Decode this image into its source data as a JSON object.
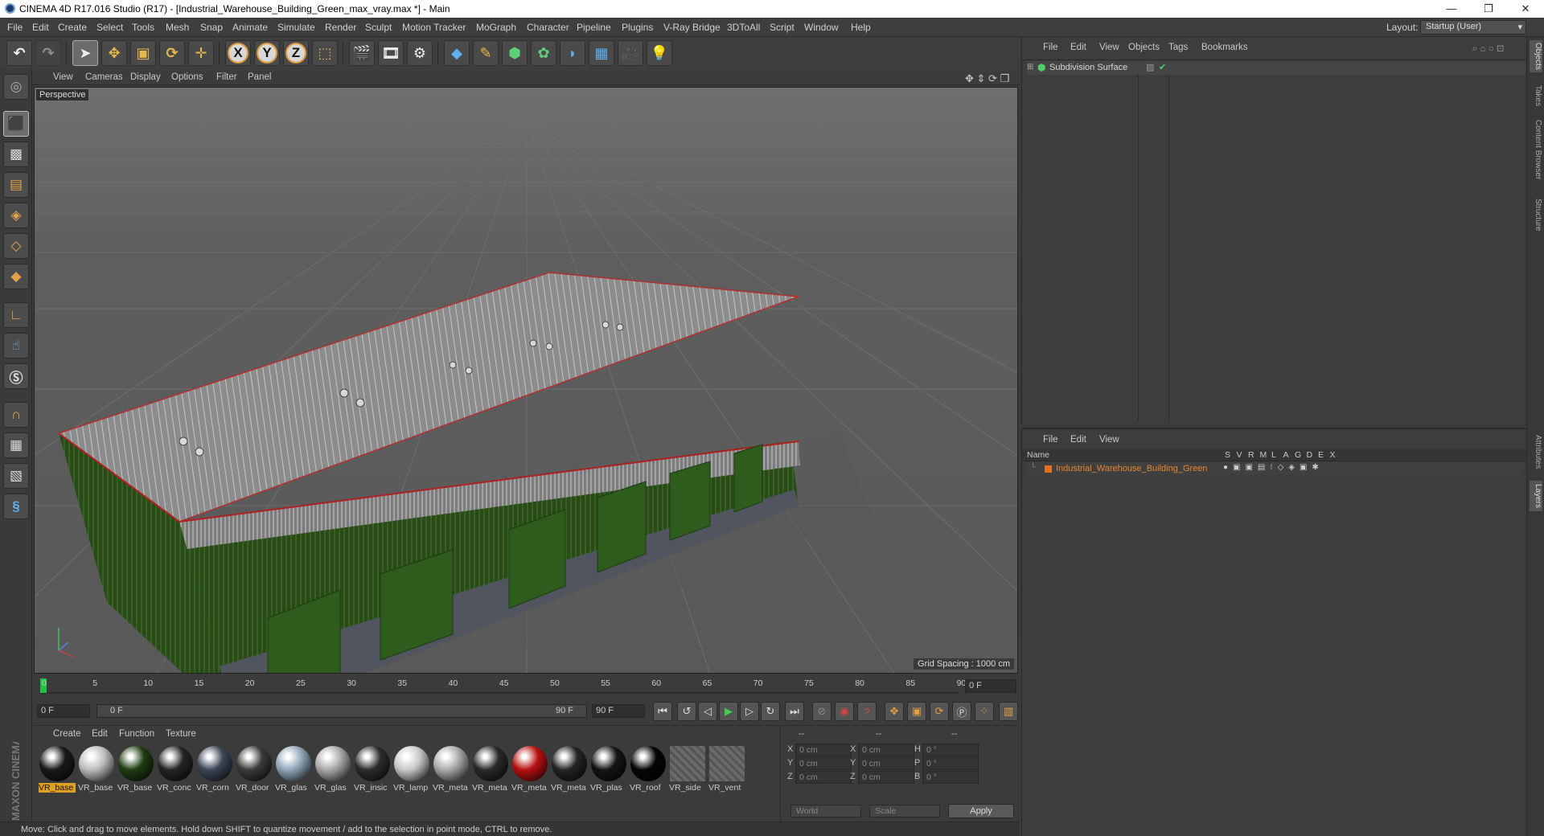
{
  "window": {
    "title": "CINEMA 4D R17.016 Studio (R17) - [Industrial_Warehouse_Building_Green_max_vray.max *] - Main",
    "controls": [
      "—",
      "❐",
      "✕"
    ]
  },
  "menu": {
    "items": [
      "File",
      "Edit",
      "Create",
      "Select",
      "Tools",
      "Mesh",
      "Snap",
      "Animate",
      "Simulate",
      "Render",
      "Sculpt",
      "Motion Tracker",
      "MoGraph",
      "Character",
      "Pipeline",
      "Plugins",
      "V-Ray Bridge",
      "3DToAll",
      "Script",
      "Window",
      "Help"
    ],
    "layout_label": "Layout:",
    "layout_value": "Startup (User)"
  },
  "toolbar": {
    "axis_x": "X",
    "axis_y": "Y",
    "axis_z": "Z"
  },
  "viewport": {
    "menu": [
      "View",
      "Cameras",
      "Display",
      "Options",
      "Filter",
      "Panel"
    ],
    "name": "Perspective",
    "grid_spacing": "Grid Spacing : 1000 cm"
  },
  "timeline": {
    "ticks": [
      "0",
      "5",
      "10",
      "15",
      "20",
      "25",
      "30",
      "35",
      "40",
      "45",
      "50",
      "55",
      "60",
      "65",
      "70",
      "75",
      "80",
      "85",
      "90"
    ],
    "current_frame": "0 F",
    "start_field": "0 F",
    "range_start": "0 F",
    "range_end": "90 F",
    "end_field": "90 F"
  },
  "materials": {
    "menu": [
      "Create",
      "Edit",
      "Function",
      "Texture"
    ],
    "items": [
      {
        "label": "VR_base",
        "color": "#1a1a1a",
        "selected": true
      },
      {
        "label": "VR_base",
        "color": "#bcbcbc",
        "selected": false
      },
      {
        "label": "VR_base",
        "color": "#1f3d12",
        "selected": false
      },
      {
        "label": "VR_conc",
        "color": "#252525",
        "selected": false
      },
      {
        "label": "VR_corn",
        "color": "#3c4656",
        "selected": false
      },
      {
        "label": "VR_door",
        "color": "#3a3a3a",
        "selected": false
      },
      {
        "label": "VR_glas",
        "color": "#8fa5b8",
        "selected": false
      },
      {
        "label": "VR_glas",
        "color": "#a8a8a8",
        "selected": false
      },
      {
        "label": "VR_insic",
        "color": "#2d2d2d",
        "selected": false
      },
      {
        "label": "VR_lamp",
        "color": "#c8c8c8",
        "selected": false
      },
      {
        "label": "VR_meta",
        "color": "#a9a9a9",
        "selected": false
      },
      {
        "label": "VR_meta",
        "color": "#2a2a2a",
        "selected": false
      },
      {
        "label": "VR_meta",
        "color": "#b81010",
        "selected": false
      },
      {
        "label": "VR_meta",
        "color": "#242424",
        "selected": false
      },
      {
        "label": "VR_plas",
        "color": "#151515",
        "selected": false
      },
      {
        "label": "VR_roof",
        "color": "#050505",
        "selected": false
      },
      {
        "label": "VR_side",
        "color": "#6a6a6a",
        "selected": false
      },
      {
        "label": "VR_vent",
        "color": "#6a6a6a",
        "selected": false
      }
    ]
  },
  "coords": {
    "headers": [
      "--",
      "--",
      "--"
    ],
    "rows": [
      {
        "a": "X",
        "av": "0 cm",
        "b": "X",
        "bv": "0 cm",
        "c": "H",
        "cv": "0 °"
      },
      {
        "a": "Y",
        "av": "0 cm",
        "b": "Y",
        "bv": "0 cm",
        "c": "P",
        "cv": "0 °"
      },
      {
        "a": "Z",
        "av": "0 cm",
        "b": "Z",
        "bv": "0 cm",
        "c": "B",
        "cv": "0 °"
      }
    ],
    "world": "World",
    "scale": "Scale",
    "apply": "Apply"
  },
  "objects": {
    "menu": [
      "File",
      "Edit",
      "View",
      "Objects",
      "Tags",
      "Bookmarks"
    ],
    "item": "Subdivision Surface"
  },
  "layers": {
    "menu": [
      "File",
      "Edit",
      "View"
    ],
    "name_header": "Name",
    "columns": [
      "S",
      "V",
      "R",
      "M",
      "L",
      "A",
      "G",
      "D",
      "E",
      "X"
    ],
    "item": "Industrial_Warehouse_Building_Green",
    "item_color": "#e07020"
  },
  "right_tabs": [
    "Objects",
    "Takes",
    "Content Browser",
    "Structure",
    "Attributes",
    "Layers"
  ],
  "status": "Move: Click and drag to move elements. Hold down SHIFT to quantize movement / add to the selection in point mode, CTRL to remove.",
  "brand": "MAXON CINEMA 4D"
}
